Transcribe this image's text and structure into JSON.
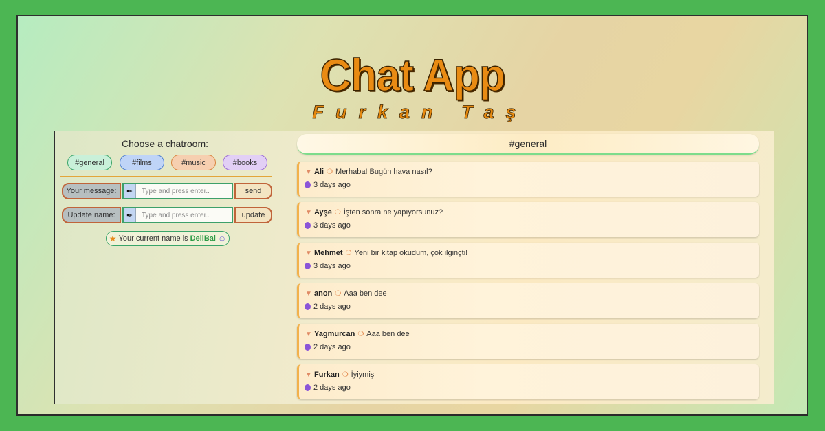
{
  "banner": {
    "title": "Chat App",
    "subtitle": "Furkan Taş"
  },
  "sidebar": {
    "choose_label": "Choose a chatroom:",
    "rooms": [
      "#general",
      "#films",
      "#music",
      "#books"
    ],
    "message": {
      "label": "Your message:",
      "placeholder": "Type and press enter..",
      "button": "send"
    },
    "update": {
      "label": "Update name:",
      "placeholder": "Type and press enter..",
      "button": "update"
    },
    "current_prefix": "Your current name is",
    "current_name": "DeliBal"
  },
  "chat": {
    "room_title": "#general",
    "messages": [
      {
        "author": "Ali",
        "text": "Merhaba! Bugün hava nasıl?",
        "time": "3 days ago"
      },
      {
        "author": "Ayşe",
        "text": "İşten sonra ne yapıyorsunuz?",
        "time": "3 days ago"
      },
      {
        "author": "Mehmet",
        "text": "Yeni bir kitap okudum, çok ilginçti!",
        "time": "3 days ago"
      },
      {
        "author": "anon",
        "text": "Aaa ben dee",
        "time": "2 days ago"
      },
      {
        "author": "Yagmurcan",
        "text": "Aaa ben dee",
        "time": "2 days ago"
      },
      {
        "author": "Furkan",
        "text": "İyiymiş",
        "time": "2 days ago"
      }
    ]
  },
  "colors": {
    "outer_green": "#4cb653",
    "title_orange": "#e98b13",
    "accent_orange": "#f2b14c",
    "name_green": "#2c9a45"
  },
  "icons": {
    "message_pin": "pin-icon",
    "text_bubble": "chat-bubble-icon",
    "time": "clock-icon",
    "input": "pen-icon",
    "current_name": "star-icon",
    "smile": "smile-icon"
  }
}
